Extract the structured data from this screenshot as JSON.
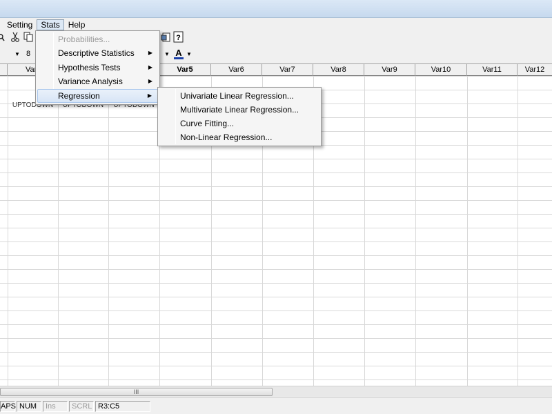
{
  "menubar": {
    "items": [
      {
        "label": "Setting",
        "active": false
      },
      {
        "label": "Stats",
        "active": true
      },
      {
        "label": "Help",
        "active": false
      }
    ]
  },
  "toolbar2": {
    "font_size_value": "8"
  },
  "grid": {
    "columns": [
      {
        "label": "Var",
        "bold": false
      },
      {
        "label": "Var5",
        "bold": true
      },
      {
        "label": "Var6",
        "bold": false
      },
      {
        "label": "Var7",
        "bold": false
      },
      {
        "label": "Var8",
        "bold": false
      },
      {
        "label": "Var9",
        "bold": false
      },
      {
        "label": "Var10",
        "bold": false
      },
      {
        "label": "Var11",
        "bold": false
      },
      {
        "label": "Var12",
        "bold": false
      }
    ],
    "cells": [
      "UPTODOWN",
      "UPTODOWN",
      "UPTODOWN"
    ]
  },
  "scrollbar": {
    "thumb_grip": "III"
  },
  "status": {
    "caps": "APS",
    "num": "NUM",
    "ins": "Ins",
    "scrl": "SCRL",
    "cell_ref": "R3:C5"
  },
  "stats_menu": {
    "items": [
      {
        "label": "Probabilities...",
        "disabled": true,
        "submenu": false
      },
      {
        "label": "Descriptive Statistics",
        "disabled": false,
        "submenu": true
      },
      {
        "label": "Hypothesis Tests",
        "disabled": false,
        "submenu": true
      },
      {
        "label": "Variance Analysis",
        "disabled": false,
        "submenu": true
      },
      {
        "label": "Regression",
        "disabled": false,
        "submenu": true,
        "highlighted": true
      }
    ]
  },
  "regression_submenu": {
    "items": [
      {
        "label": "Univariate Linear Regression..."
      },
      {
        "label": "Multivariate Linear Regression..."
      },
      {
        "label": "Curve Fitting..."
      },
      {
        "label": "Non-Linear Regression..."
      }
    ]
  }
}
